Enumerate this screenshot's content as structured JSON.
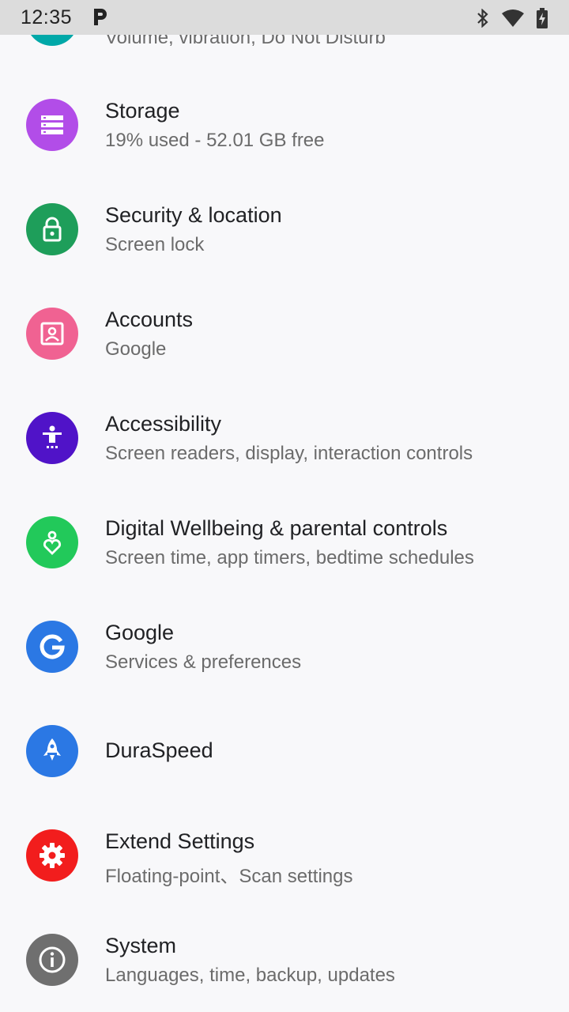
{
  "status_bar": {
    "time": "12:35",
    "icons": [
      "parking-p-icon",
      "bluetooth-icon",
      "wifi-icon",
      "battery-charging-icon"
    ]
  },
  "settings": {
    "sound": {
      "subtitle": "Volume, vibration, Do Not Disturb",
      "icon": "sound-icon",
      "color": "#00a8a8"
    },
    "storage": {
      "title": "Storage",
      "subtitle": "19% used - 52.01 GB free",
      "icon": "storage-icon",
      "color": "#b24de8"
    },
    "security": {
      "title": "Security & location",
      "subtitle": "Screen lock",
      "icon": "lock-icon",
      "color": "#1e9e5a"
    },
    "accounts": {
      "title": "Accounts",
      "subtitle": "Google",
      "icon": "account-box-icon",
      "color": "#f06292"
    },
    "accessibility": {
      "title": "Accessibility",
      "subtitle": "Screen readers, display, interaction controls",
      "icon": "accessibility-icon",
      "color": "#5013c8"
    },
    "wellbeing": {
      "title": "Digital Wellbeing & parental controls",
      "subtitle": "Screen time, app timers, bedtime schedules",
      "icon": "wellbeing-heart-icon",
      "color": "#22c95a"
    },
    "google": {
      "title": "Google",
      "subtitle": "Services & preferences",
      "icon": "google-g-icon",
      "color": "#2b78e4"
    },
    "duraspeed": {
      "title": "DuraSpeed",
      "icon": "rocket-icon",
      "color": "#2b78e4"
    },
    "extend": {
      "title": "Extend Settings",
      "subtitle": "Floating-point、Scan settings",
      "icon": "gear-icon",
      "color": "#f21d1d"
    },
    "system": {
      "title": "System",
      "subtitle": "Languages, time, backup, updates",
      "icon": "info-icon",
      "color": "#6f6f6f"
    }
  }
}
